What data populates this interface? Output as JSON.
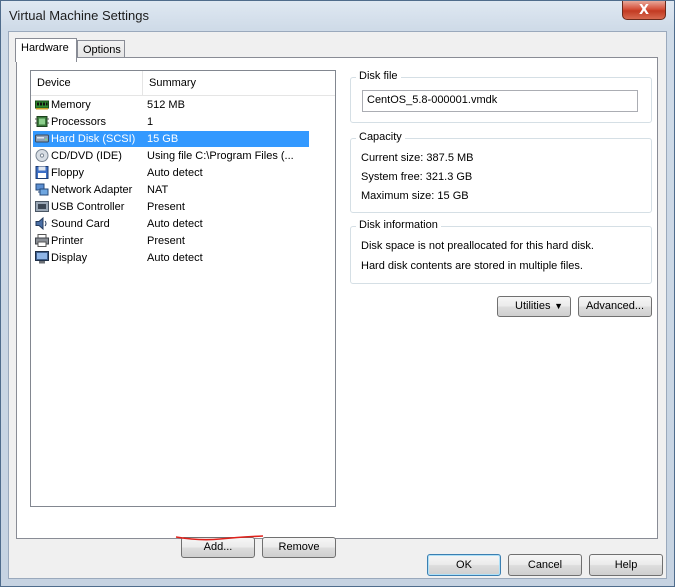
{
  "window": {
    "title": "Virtual Machine Settings",
    "close_label": "X"
  },
  "tabs": [
    {
      "label": "Hardware",
      "active": true
    },
    {
      "label": "Options",
      "active": false
    }
  ],
  "device_list": {
    "columns": [
      "Device",
      "Summary"
    ],
    "rows": [
      {
        "device": "Memory",
        "summary": "512 MB",
        "icon": "memory-icon",
        "selected": false
      },
      {
        "device": "Processors",
        "summary": "1",
        "icon": "processor-icon",
        "selected": false
      },
      {
        "device": "Hard Disk (SCSI)",
        "summary": "15 GB",
        "icon": "hard-disk-icon",
        "selected": true
      },
      {
        "device": "CD/DVD (IDE)",
        "summary": "Using file C:\\Program Files (...",
        "icon": "cd-dvd-icon",
        "selected": false
      },
      {
        "device": "Floppy",
        "summary": "Auto detect",
        "icon": "floppy-icon",
        "selected": false
      },
      {
        "device": "Network Adapter",
        "summary": "NAT",
        "icon": "network-adapter-icon",
        "selected": false
      },
      {
        "device": "USB Controller",
        "summary": "Present",
        "icon": "usb-controller-icon",
        "selected": false
      },
      {
        "device": "Sound Card",
        "summary": "Auto detect",
        "icon": "sound-card-icon",
        "selected": false
      },
      {
        "device": "Printer",
        "summary": "Present",
        "icon": "printer-icon",
        "selected": false
      },
      {
        "device": "Display",
        "summary": "Auto detect",
        "icon": "display-icon",
        "selected": false
      }
    ]
  },
  "list_buttons": {
    "add": "Add...",
    "remove": "Remove"
  },
  "disk_file": {
    "label": "Disk file",
    "value": "CentOS_5.8-000001.vmdk"
  },
  "capacity": {
    "label": "Capacity",
    "current_size": "Current size:  387.5 MB",
    "system_free": "System free:  321.3 GB",
    "maximum_size": "Maximum size:  15 GB"
  },
  "disk_information": {
    "label": "Disk information",
    "line1": "Disk space is not preallocated for this hard disk.",
    "line2": "Hard disk contents are stored in multiple files."
  },
  "disk_buttons": {
    "utilities": "Utilities",
    "advanced": "Advanced..."
  },
  "dialog_buttons": {
    "ok": "OK",
    "cancel": "Cancel",
    "help": "Help"
  },
  "colors": {
    "selection": "#3399ff",
    "annotation_underline": "#e0201a"
  }
}
